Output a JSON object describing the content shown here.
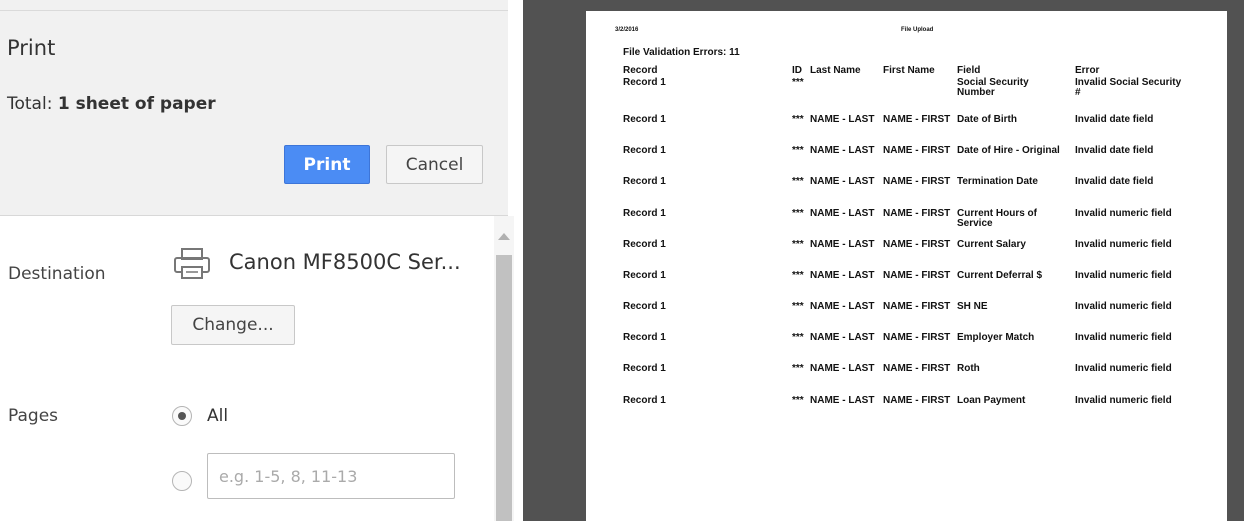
{
  "dialog": {
    "title": "Print",
    "total_label": "Total:",
    "total_value": "1 sheet of paper",
    "print_label": "Print",
    "cancel_label": "Cancel"
  },
  "destination": {
    "label": "Destination",
    "printer_name": "Canon MF8500C Ser...",
    "printer_icon": "printer-icon",
    "change_label": "Change..."
  },
  "pages": {
    "label": "Pages",
    "all_label": "All",
    "all_selected": true,
    "custom_placeholder": "e.g. 1-5, 8, 11-13"
  },
  "preview": {
    "date": "3/2/2016",
    "header_title": "File Upload",
    "errors_label": "File Validation Errors: 11",
    "columns": [
      "Record",
      "ID",
      "Last Name",
      "First Name",
      "Field",
      "Error"
    ],
    "rows": [
      {
        "record": "Record 1",
        "id": "***",
        "last": "",
        "first": "",
        "field": "Social Security Number",
        "error": "Invalid Social Security #"
      },
      {
        "record": "Record 1",
        "id": "***",
        "last": "NAME - LAST",
        "first": "NAME - FIRST",
        "field": "Date of Birth",
        "error": "Invalid date field"
      },
      {
        "record": "Record 1",
        "id": "***",
        "last": "NAME - LAST",
        "first": "NAME - FIRST",
        "field": "Date of Hire - Original",
        "error": "Invalid date field"
      },
      {
        "record": "Record 1",
        "id": "***",
        "last": "NAME - LAST",
        "first": "NAME - FIRST",
        "field": "Termination Date",
        "error": "Invalid date field"
      },
      {
        "record": "Record 1",
        "id": "***",
        "last": "NAME - LAST",
        "first": "NAME - FIRST",
        "field": "Current Hours of Service",
        "error": "Invalid numeric field"
      },
      {
        "record": "Record 1",
        "id": "***",
        "last": "NAME - LAST",
        "first": "NAME - FIRST",
        "field": "Current Salary",
        "error": "Invalid numeric field"
      },
      {
        "record": "Record 1",
        "id": "***",
        "last": "NAME - LAST",
        "first": "NAME - FIRST",
        "field": "Current Deferral $",
        "error": "Invalid numeric field"
      },
      {
        "record": "Record 1",
        "id": "***",
        "last": "NAME - LAST",
        "first": "NAME - FIRST",
        "field": "SH NE",
        "error": "Invalid numeric field"
      },
      {
        "record": "Record 1",
        "id": "***",
        "last": "NAME - LAST",
        "first": "NAME - FIRST",
        "field": "Employer Match",
        "error": "Invalid numeric field"
      },
      {
        "record": "Record 1",
        "id": "***",
        "last": "NAME - LAST",
        "first": "NAME - FIRST",
        "field": "Roth",
        "error": "Invalid numeric field"
      },
      {
        "record": "Record 1",
        "id": "***",
        "last": "NAME - LAST",
        "first": "NAME - FIRST",
        "field": "Loan Payment",
        "error": "Invalid numeric field"
      }
    ]
  }
}
